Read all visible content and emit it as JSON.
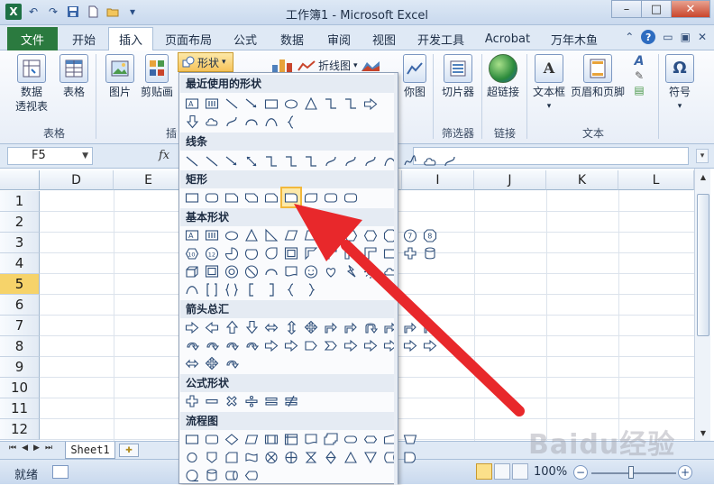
{
  "window": {
    "title": "工作簿1 - Microsoft Excel",
    "minimize": "–",
    "maximize": "□",
    "close": "✕"
  },
  "tabs": [
    {
      "label": "文件",
      "active": false
    },
    {
      "label": "开始",
      "active": false
    },
    {
      "label": "插入",
      "active": true
    },
    {
      "label": "页面布局",
      "active": false
    },
    {
      "label": "公式",
      "active": false
    },
    {
      "label": "数据",
      "active": false
    },
    {
      "label": "审阅",
      "active": false
    },
    {
      "label": "视图",
      "active": false
    },
    {
      "label": "开发工具",
      "active": false
    },
    {
      "label": "Acrobat",
      "active": false
    },
    {
      "label": "万年木鱼",
      "active": false
    }
  ],
  "ribbon": {
    "pivot_label_1": "数据",
    "pivot_label_2": "透视表",
    "table_label": "表格",
    "group_tables": "表格",
    "picture_label": "图片",
    "clipart_label": "剪贴画",
    "group_illus_short": "插",
    "shapes_label": "形状",
    "linechart_label": "折线图",
    "sparkline_label_partial": "你图",
    "slicer_label": "切片器",
    "group_filter": "筛选器",
    "hyperlink_label": "超链接",
    "group_links": "链接",
    "textbox_label": "文本框",
    "headerfooter_label": "页眉和页脚",
    "group_text": "文本",
    "symbol_label": "符号",
    "symbol_glyph": "Ω"
  },
  "formula_bar": {
    "name_box": "F5",
    "fx": "fx",
    "value": ""
  },
  "grid": {
    "columns": [
      "D",
      "E",
      "I",
      "J",
      "K",
      "L"
    ],
    "rows": [
      "1",
      "2",
      "3",
      "4",
      "5",
      "6",
      "7",
      "8",
      "9",
      "10",
      "11",
      "12"
    ],
    "active_row": "5"
  },
  "shapes_menu": {
    "sections": [
      {
        "title": "最近使用的形状"
      },
      {
        "title": "线条"
      },
      {
        "title": "矩形"
      },
      {
        "title": "基本形状"
      },
      {
        "title": "箭头总汇"
      },
      {
        "title": "公式形状"
      },
      {
        "title": "流程图"
      }
    ]
  },
  "sheets": [
    "Sheet1"
  ],
  "status": {
    "ready": "就绪",
    "zoom": "100%",
    "zoom_level": 1.0
  },
  "watermark": "Baidu经验",
  "colors": {
    "file_tab": "#2b7a3f",
    "active_row_header": "#f6d36a",
    "arrow": "#e8282b",
    "highlight": "#f2b83b"
  }
}
